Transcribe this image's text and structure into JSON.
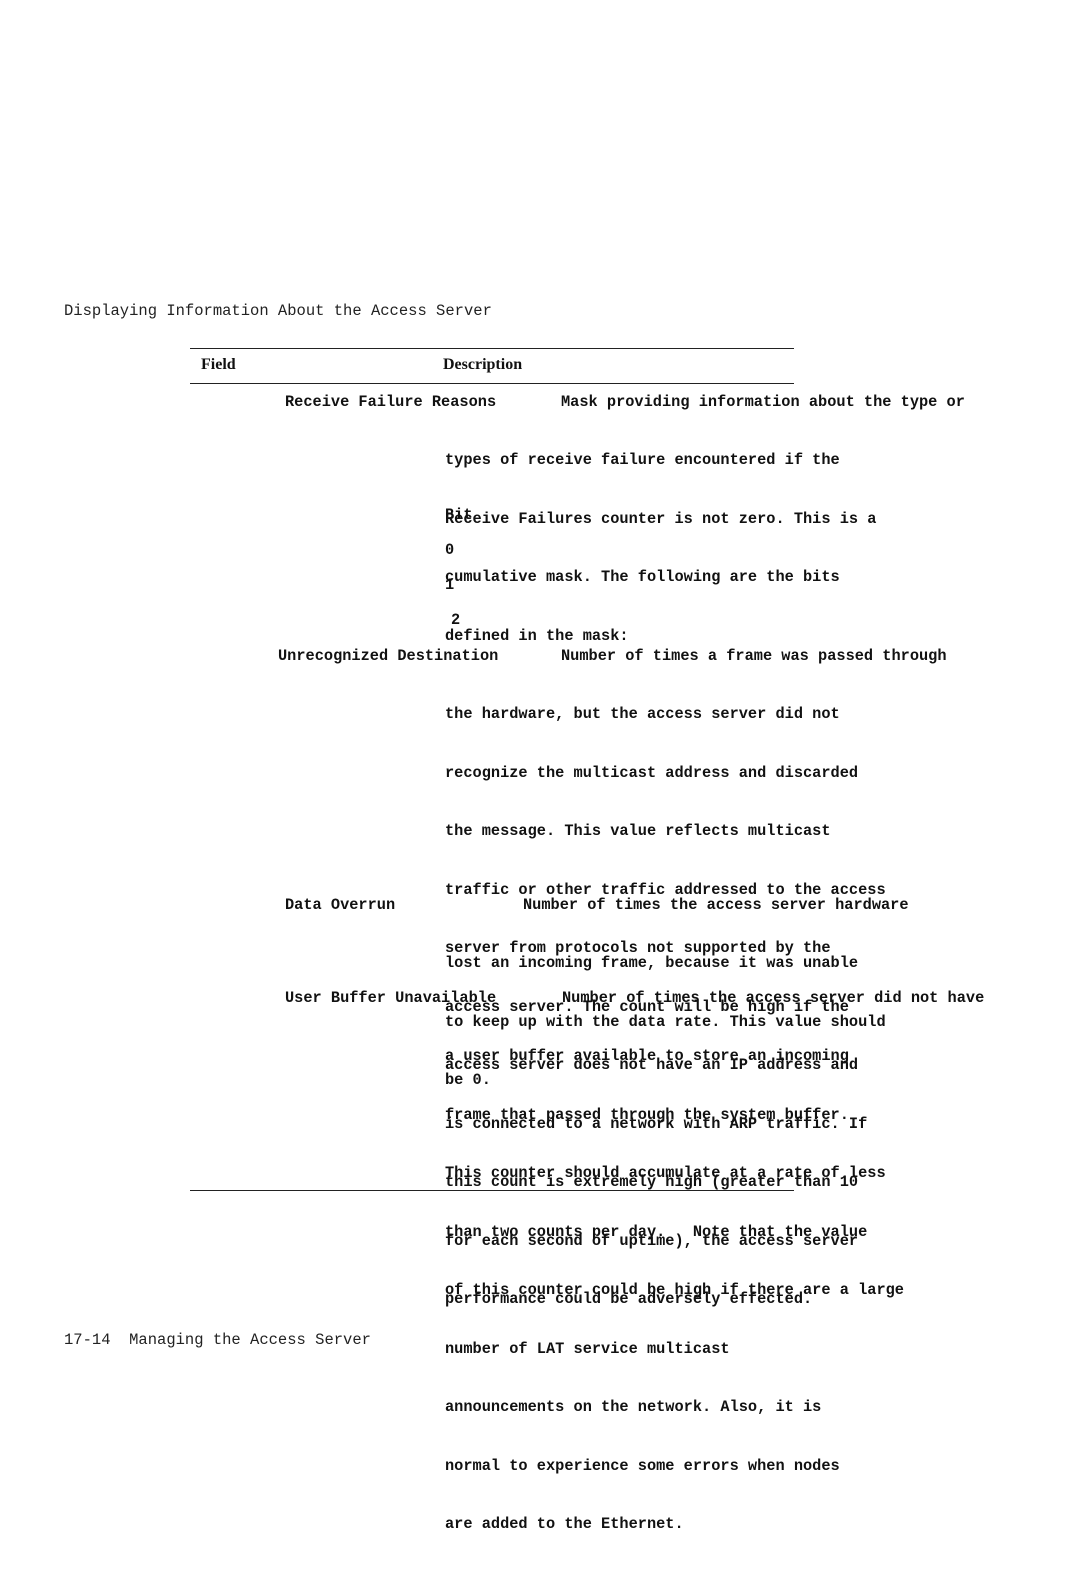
{
  "page": {
    "running_head": "Displaying Information About the Access Server",
    "footer": "17-14  Managing the Access Server"
  },
  "table": {
    "headers": {
      "field": "Field",
      "description": "Description"
    },
    "rows": [
      {
        "field": "Receive Failure Reasons",
        "first_line": "Mask providing information about the type or",
        "lines": [
          "types of receive failure encountered if the",
          "Receive Failures counter is not zero. This is a",
          "cumulative mask. The following are the bits",
          "defined in the mask:"
        ],
        "bits": {
          "header": "Bit",
          "values": [
            "0",
            "1",
            "2"
          ]
        }
      },
      {
        "field": "Unrecognized Destination",
        "first_line": "Number of times a frame was passed through",
        "lines": [
          "the hardware, but the access server did not",
          "recognize the multicast address and discarded",
          "the message. This value reflects multicast",
          "traffic or other traffic addressed to the access",
          "server from protocols not supported by the",
          "access server. The count will be high if the",
          "access server does not have an IP address and",
          "is connected to a network with ARP traffic. If",
          "this count is extremely high (greater than 10",
          "for each second of uptime), the access server",
          "performance could be adversely effected."
        ]
      },
      {
        "field": "Data Overrun",
        "first_line": "Number of times the access server hardware",
        "lines": [
          "lost an incoming frame, because it was unable",
          "to keep up with the data rate. This value should",
          "be 0."
        ]
      },
      {
        "field": "User Buffer Unavailable",
        "first_line": "Number of times the access server did not have",
        "lines": [
          "a user buffer available to store an incoming",
          "frame that passed through the system buffer.",
          "This counter should accumulate at a rate of less",
          "than two counts per day.   Note that the value",
          "of this counter could be high if there are a large",
          "number of LAT service multicast",
          "announcements on the network. Also, it is",
          "normal to experience some errors when nodes",
          "are added to the Ethernet."
        ]
      }
    ]
  }
}
